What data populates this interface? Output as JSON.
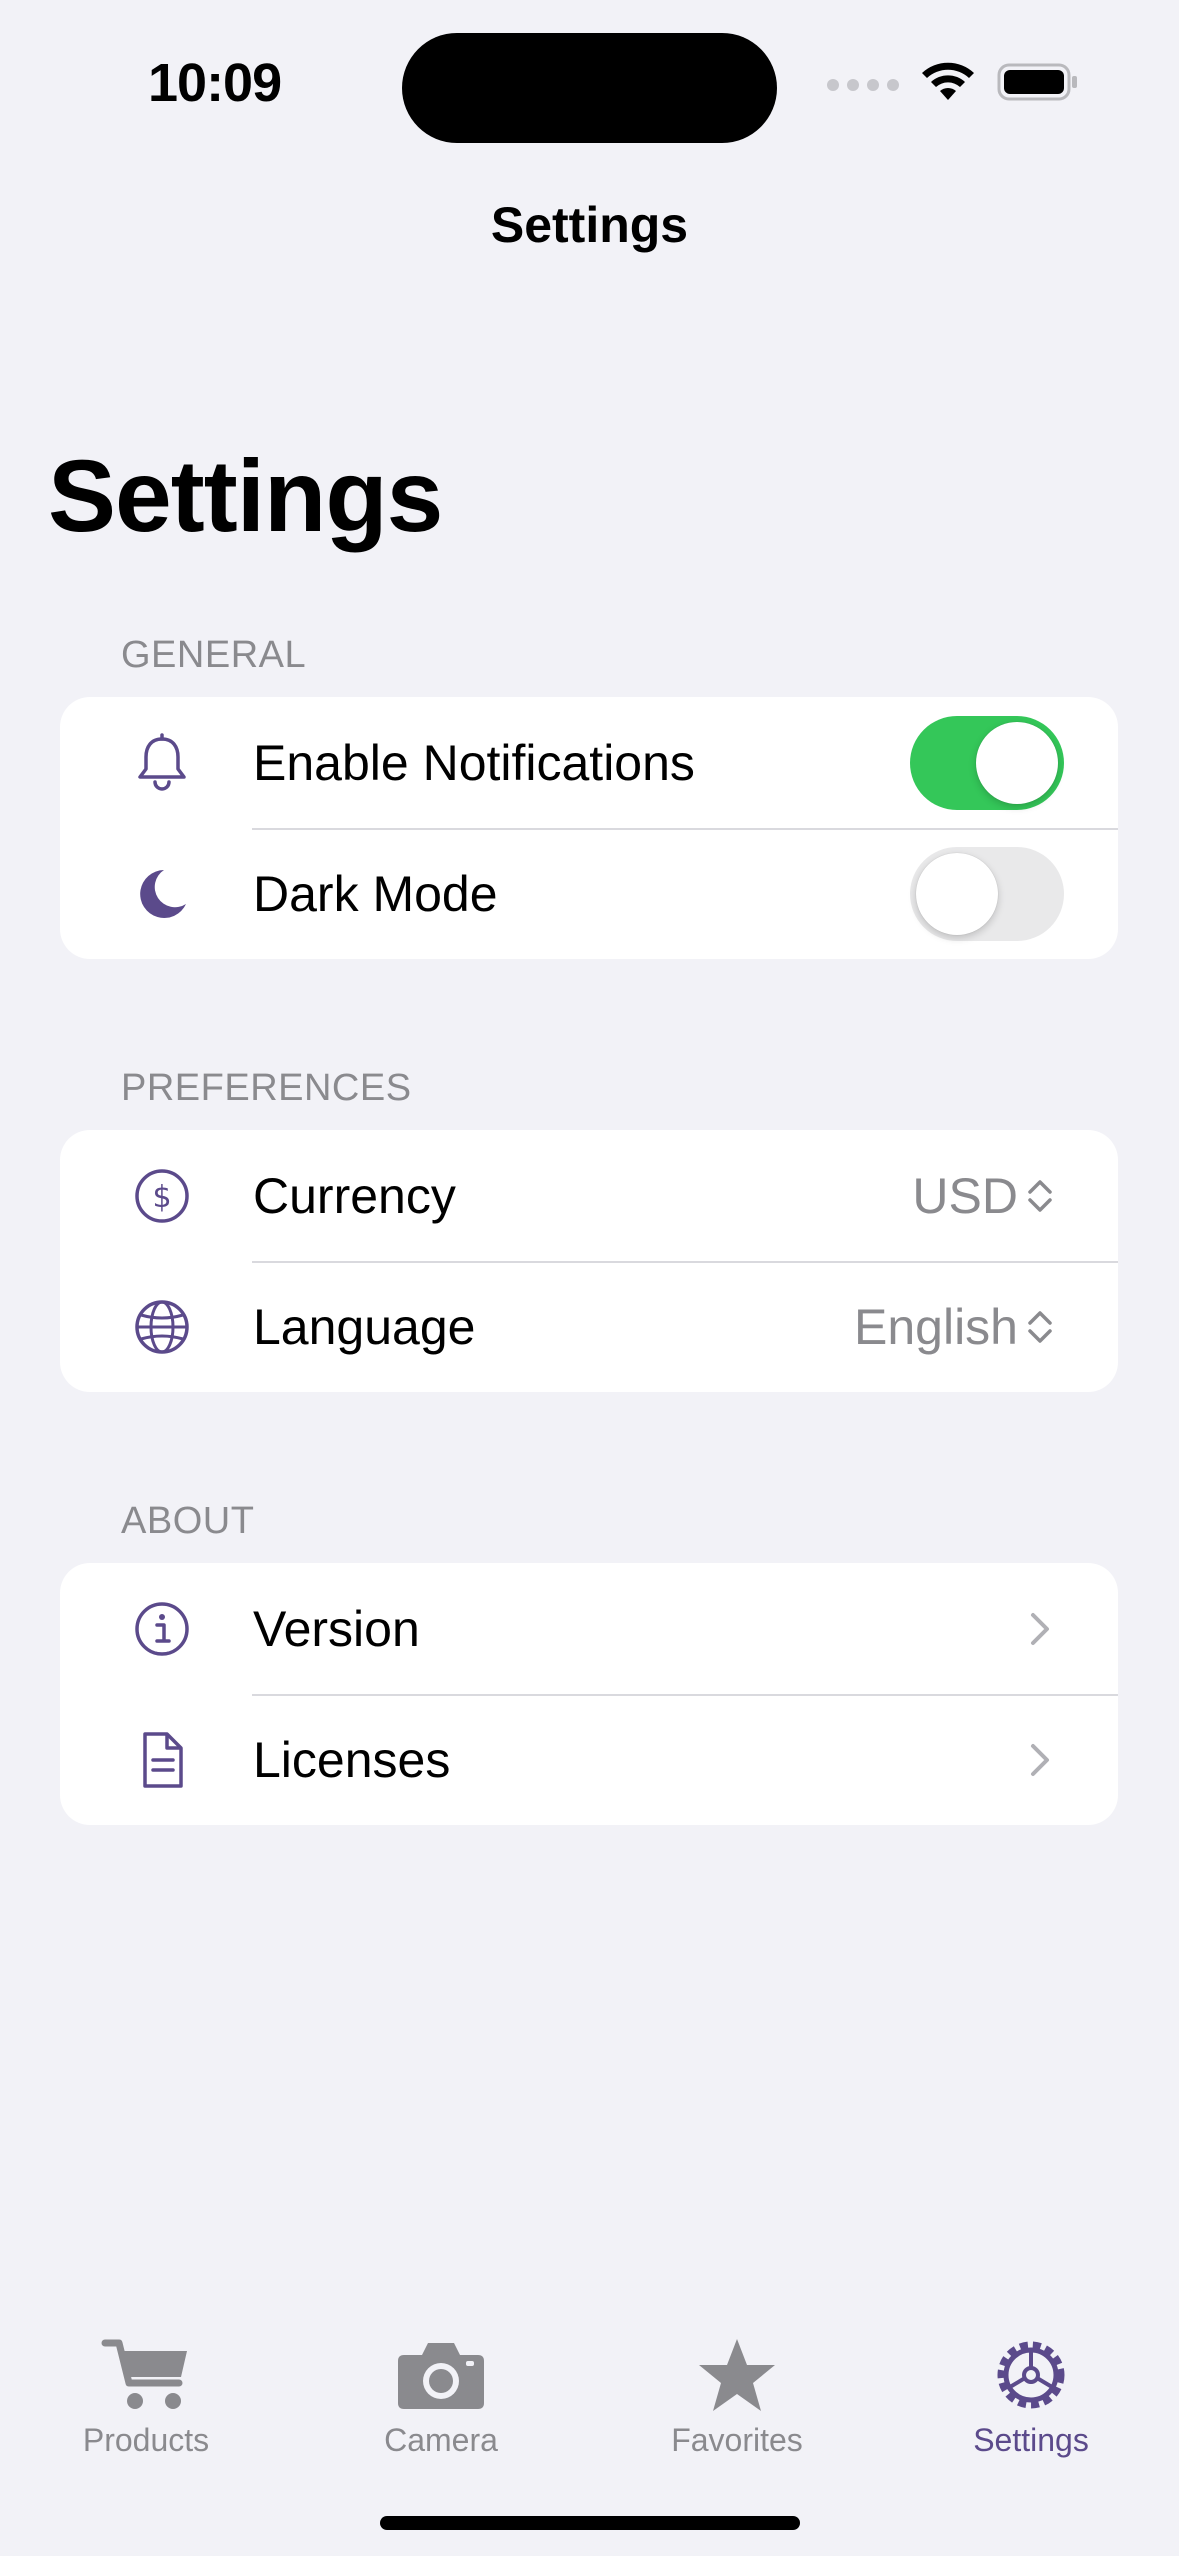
{
  "status_bar": {
    "time": "10:09"
  },
  "nav": {
    "title": "Settings",
    "large_title": "Settings"
  },
  "colors": {
    "accent": "#5b4a8b",
    "toggle_on": "#34c759",
    "toggle_off": "#e9e9ea",
    "secondary_text": "#8a8a8e"
  },
  "sections": {
    "general": {
      "header": "GENERAL",
      "rows": [
        {
          "label": "Enable Notifications",
          "icon": "bell-icon",
          "toggle_on": true
        },
        {
          "label": "Dark Mode",
          "icon": "moon-icon",
          "toggle_on": false
        }
      ]
    },
    "preferences": {
      "header": "PREFERENCES",
      "rows": [
        {
          "label": "Currency",
          "icon": "dollar-circle-icon",
          "value": "USD"
        },
        {
          "label": "Language",
          "icon": "globe-icon",
          "value": "English"
        }
      ]
    },
    "about": {
      "header": "ABOUT",
      "rows": [
        {
          "label": "Version",
          "icon": "info-circle-icon"
        },
        {
          "label": "Licenses",
          "icon": "document-icon"
        }
      ]
    }
  },
  "tabbar": {
    "tabs": [
      {
        "label": "Products",
        "icon": "cart-icon",
        "active": false
      },
      {
        "label": "Camera",
        "icon": "camera-icon",
        "active": false
      },
      {
        "label": "Favorites",
        "icon": "star-icon",
        "active": false
      },
      {
        "label": "Settings",
        "icon": "gear-icon",
        "active": true
      }
    ]
  }
}
